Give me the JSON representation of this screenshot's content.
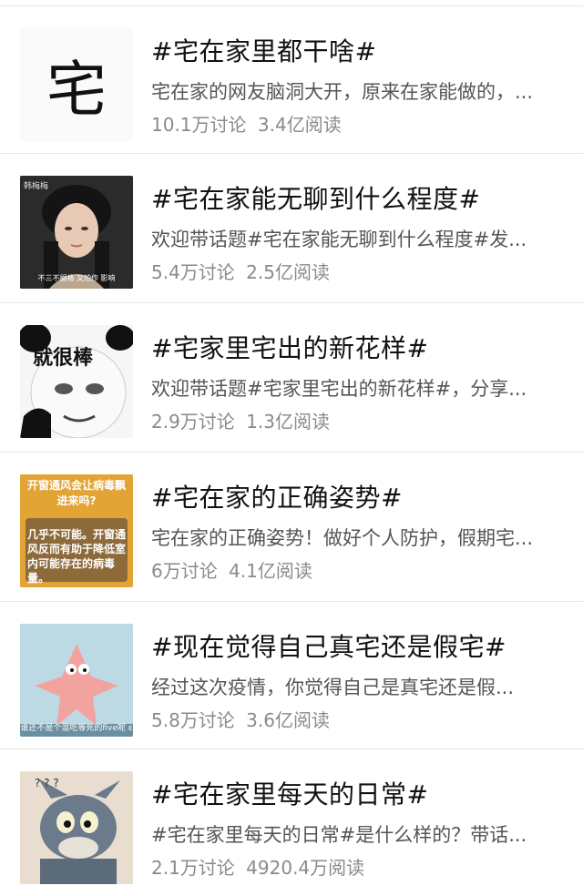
{
  "topics": [
    {
      "title": "#宅在家里都干啥#",
      "desc": "宅在家的网友脑洞大开，原来在家能做的，...",
      "discuss": "10.1万讨论",
      "read": "3.4亿阅读",
      "thumb_text": "宅"
    },
    {
      "title": "#宅在家能无聊到什么程度#",
      "desc": "欢迎带话题#宅在家能无聊到什么程度#发...",
      "discuss": "5.4万讨论",
      "read": "2.5亿阅读",
      "thumb_text": "韩梅梅",
      "thumb_sub": "不三不搁格 又怕作 影响"
    },
    {
      "title": "#宅家里宅出的新花样#",
      "desc": "欢迎带话题#宅家里宅出的新花样#，分享...",
      "discuss": "2.9万讨论",
      "read": "1.3亿阅读",
      "thumb_text": "就很棒"
    },
    {
      "title": "#宅在家的正确姿势#",
      "desc": "宅在家的正确姿势！做好个人防护，假期宅...",
      "discuss": "6万讨论",
      "read": "4.1亿阅读",
      "thumb_question": "开窗通风会让病毒飘进来吗?",
      "thumb_answer": "几乎不可能。开窗通风反而有助于降低室内可能存在的病毒量。"
    },
    {
      "title": "#现在觉得自己真宅还是假宅#",
      "desc": "经过这次疫情，你觉得自己是真宅还是假...",
      "discuss": "5.8万讨论",
      "read": "3.6亿阅读",
      "thumb_text": "谁还不是个混吃等死的five呢 ε"
    },
    {
      "title": "#宅在家里每天的日常#",
      "desc": "#宅在家里每天的日常#是什么样的？带话...",
      "discuss": "2.1万讨论",
      "read": "4920.4万阅读",
      "thumb_text": "? ? ?"
    }
  ]
}
